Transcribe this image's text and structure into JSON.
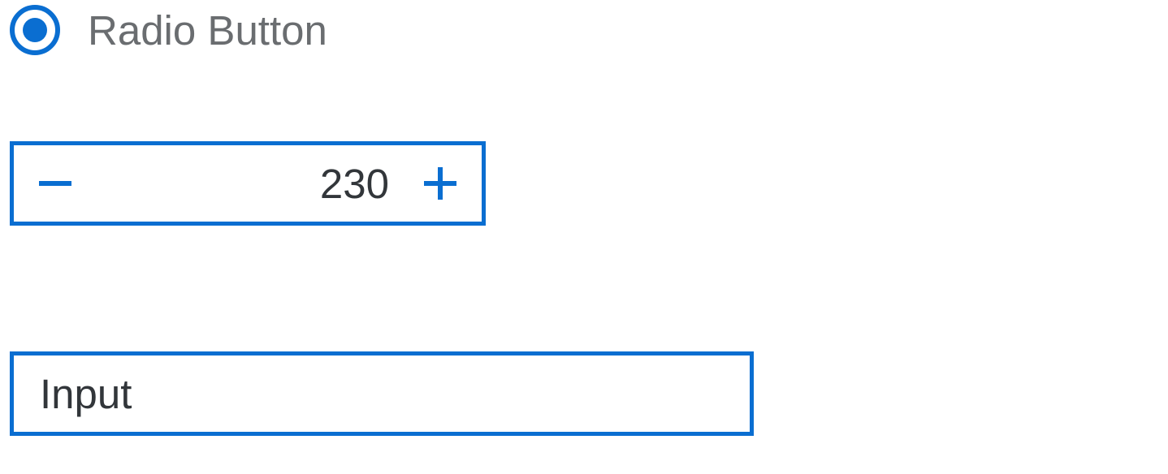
{
  "radio": {
    "label": "Radio Button",
    "selected": true
  },
  "stepper": {
    "value": "230"
  },
  "input": {
    "value": "Input"
  },
  "colors": {
    "accent": "#0a6ed1",
    "text_dark": "#32363a",
    "text_grey": "#6a6d70"
  }
}
